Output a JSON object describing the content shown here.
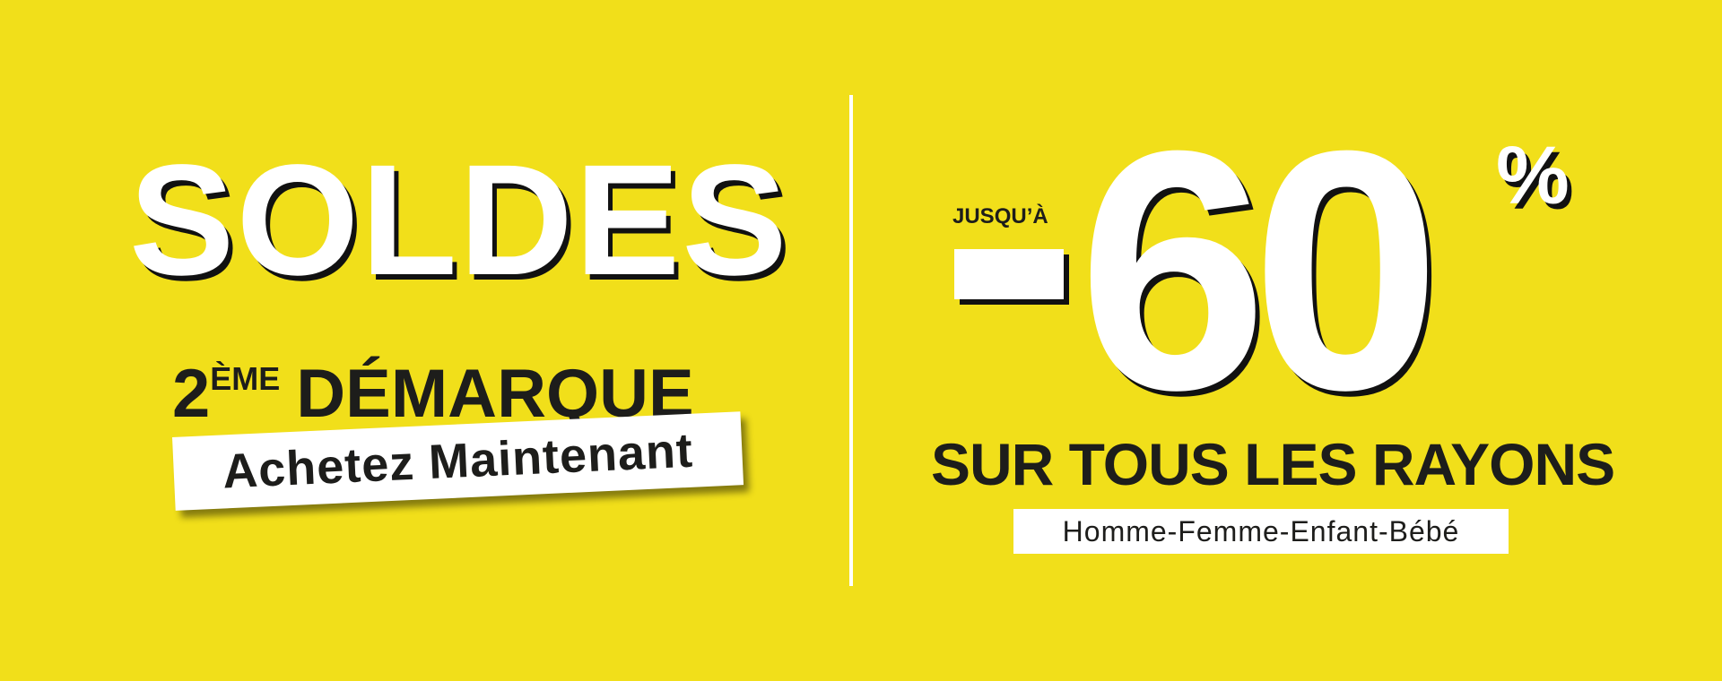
{
  "banner": {
    "background_color": "#f1df1a",
    "accent_text_color": "#ffffff",
    "dark_text_color": "#1d1d1b"
  },
  "left": {
    "title": "SOLDES",
    "markdown_number": "2",
    "markdown_suffix": "ÈME",
    "markdown_label": "DÉMARQUE",
    "cta_label": "Achetez Maintenant"
  },
  "right": {
    "prefix": "JUSQU’À",
    "discount_value": "60",
    "percent_sign": "%",
    "headline": "SUR TOUS LES RAYONS",
    "categories": "Homme-Femme-Enfant-Bébé"
  }
}
